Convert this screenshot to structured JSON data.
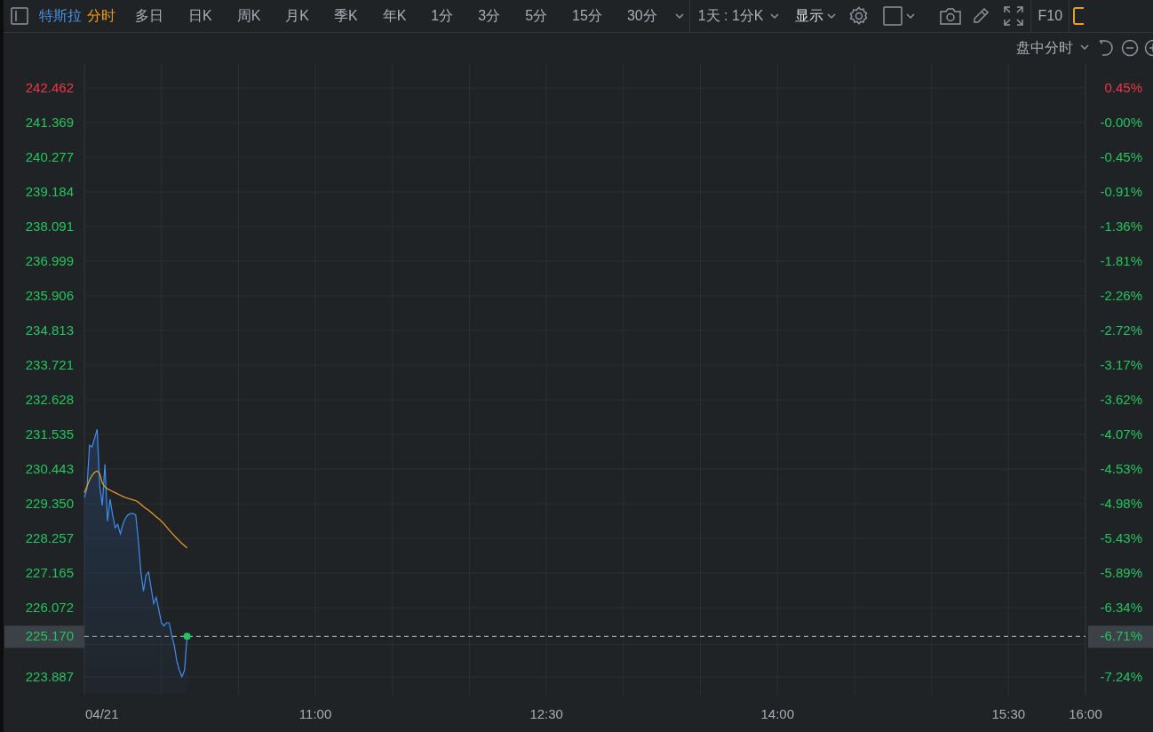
{
  "toolbar": {
    "stock_name": "特斯拉",
    "periods": [
      {
        "label": "分时",
        "selected": true
      },
      {
        "label": "多日",
        "selected": false
      },
      {
        "label": "日K",
        "selected": false
      },
      {
        "label": "周K",
        "selected": false
      },
      {
        "label": "月K",
        "selected": false
      },
      {
        "label": "季K",
        "selected": false
      },
      {
        "label": "年K",
        "selected": false
      },
      {
        "label": "1分",
        "selected": false
      },
      {
        "label": "3分",
        "selected": false
      },
      {
        "label": "5分",
        "selected": false
      },
      {
        "label": "15分",
        "selected": false
      },
      {
        "label": "30分",
        "selected": false
      }
    ],
    "range_select": "1天 : 1分K",
    "display_select": "显示",
    "f10": "F10"
  },
  "subbar": {
    "mode_select": "盘中分时"
  },
  "price_scale": [
    {
      "color": "#f23645"
    },
    {
      "color": "#21c55d"
    },
    {
      "color": "#21c55d"
    },
    {
      "color": "#21c55d"
    },
    {
      "color": "#21c55d"
    },
    {
      "color": "#21c55d"
    },
    {
      "color": "#21c55d"
    },
    {
      "color": "#21c55d"
    },
    {
      "color": "#21c55d"
    },
    {
      "color": "#21c55d"
    },
    {
      "color": "#21c55d"
    },
    {
      "color": "#21c55d"
    },
    {
      "color": "#21c55d"
    },
    {
      "color": "#21c55d"
    },
    {
      "color": "#21c55d"
    },
    {
      "color": "#21c55d"
    },
    {
      "color": "#21c55d"
    }
  ],
  "percent_scale": [
    {
      "label": "0.45%",
      "color": "#f23645"
    },
    {
      "label": "-0.00%",
      "color": "#21c55d"
    },
    {
      "label": "-0.45%",
      "color": "#21c55d"
    },
    {
      "label": "-0.91%",
      "color": "#21c55d"
    },
    {
      "label": "-1.36%",
      "color": "#21c55d"
    },
    {
      "label": "-1.81%",
      "color": "#21c55d"
    },
    {
      "label": "-2.26%",
      "color": "#21c55d"
    },
    {
      "label": "-2.72%",
      "color": "#21c55d"
    },
    {
      "label": "-3.17%",
      "color": "#21c55d"
    },
    {
      "label": "-3.62%",
      "color": "#21c55d"
    },
    {
      "label": "-4.07%",
      "color": "#21c55d"
    },
    {
      "label": "-4.53%",
      "color": "#21c55d"
    },
    {
      "label": "-4.98%",
      "color": "#21c55d"
    },
    {
      "label": "-5.43%",
      "color": "#21c55d"
    },
    {
      "label": "-5.89%",
      "color": "#21c55d"
    },
    {
      "label": "-6.34%",
      "color": "#21c55d"
    },
    {
      "label": "-7.24%",
      "color": "#21c55d"
    }
  ],
  "current": {
    "price_label": "225.170",
    "percent_label": "-6.71%"
  },
  "date_label": "04/21",
  "chart_data": {
    "type": "line",
    "grid": true,
    "ref_lines": [
      {
        "axis": "y",
        "value": 225.17
      }
    ],
    "xlim": [
      9.5,
      16
    ],
    "ylim": [
      223.33,
      243.22
    ],
    "xticks": [
      {
        "value": 11,
        "label": "11:00"
      },
      {
        "value": 12.5,
        "label": "12:30"
      },
      {
        "value": 14,
        "label": "14:00"
      },
      {
        "value": 15.5,
        "label": "15:30"
      },
      {
        "value": 16,
        "label": "16:00"
      }
    ],
    "yticks": [
      {
        "value": 242.462,
        "label": "242.462"
      },
      {
        "value": 241.369,
        "label": "241.369"
      },
      {
        "value": 240.277,
        "label": "240.277"
      },
      {
        "value": 239.184,
        "label": "239.184"
      },
      {
        "value": 238.091,
        "label": "238.091"
      },
      {
        "value": 236.999,
        "label": "236.999"
      },
      {
        "value": 235.906,
        "label": "235.906"
      },
      {
        "value": 234.813,
        "label": "234.813"
      },
      {
        "value": 233.721,
        "label": "233.721"
      },
      {
        "value": 232.628,
        "label": "232.628"
      },
      {
        "value": 231.535,
        "label": "231.535"
      },
      {
        "value": 230.443,
        "label": "230.443"
      },
      {
        "value": 229.35,
        "label": "229.350"
      },
      {
        "value": 228.257,
        "label": "228.257"
      },
      {
        "value": 227.165,
        "label": "227.165"
      },
      {
        "value": 226.072,
        "label": "226.072"
      },
      {
        "value": 223.887,
        "label": "223.887"
      }
    ],
    "x": [
      9.5,
      9.5167,
      9.5333,
      9.55,
      9.5667,
      9.5833,
      9.6,
      9.6167,
      9.6333,
      9.65,
      9.6667,
      9.6833,
      9.7,
      9.7167,
      9.7333,
      9.75,
      9.7667,
      9.7833,
      9.8,
      9.8167,
      9.8333,
      9.85,
      9.8667,
      9.8833,
      9.9,
      9.9167,
      9.9333,
      9.95,
      9.9667,
      9.9833,
      10,
      10.0167,
      10.0333,
      10.05,
      10.0667,
      10.0833,
      10.1,
      10.1167,
      10.1333,
      10.15,
      10.1667
    ],
    "series": [
      {
        "color": "#3d8ef0",
        "values": [
          229.55,
          229.83,
          231.2,
          231.14,
          231.43,
          231.7,
          229.9,
          229.3,
          230.6,
          228.8,
          229.5,
          229.0,
          228.6,
          228.7,
          228.4,
          228.7,
          228.9,
          229.0,
          229.04,
          229.04,
          229.0,
          228.2,
          227.2,
          226.6,
          227.1,
          227.2,
          226.7,
          226.2,
          226.4,
          226.0,
          225.6,
          225.5,
          225.6,
          225.6,
          225.2,
          224.9,
          224.4,
          224.1,
          223.9,
          224.1,
          225.17
        ]
      },
      {
        "color": "#f0a020",
        "values": [
          229.7,
          229.9,
          230.1,
          230.25,
          230.35,
          230.38,
          230.3,
          230.0,
          229.88,
          229.82,
          229.78,
          229.74,
          229.7,
          229.66,
          229.62,
          229.58,
          229.55,
          229.52,
          229.5,
          229.47,
          229.45,
          229.4,
          229.33,
          229.26,
          229.2,
          229.15,
          229.08,
          229.01,
          228.94,
          228.88,
          228.8,
          228.72,
          228.62,
          228.52,
          228.43,
          228.35,
          228.26,
          228.18,
          228.1,
          228.03,
          227.96
        ]
      }
    ]
  }
}
